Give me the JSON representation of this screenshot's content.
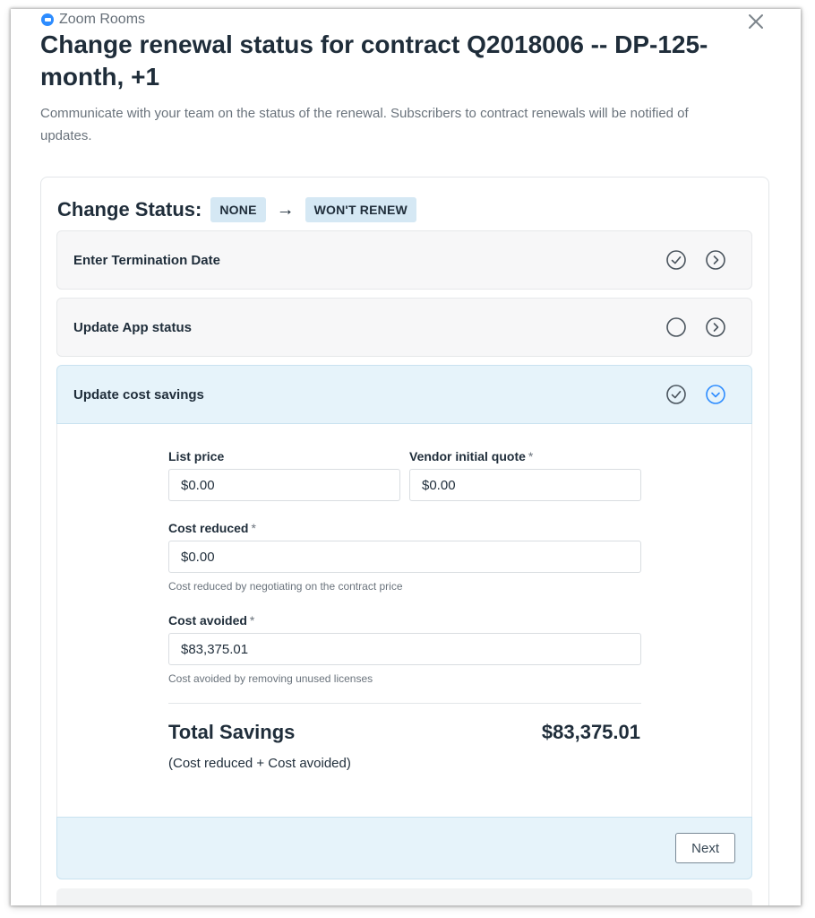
{
  "app": {
    "name": "Zoom Rooms"
  },
  "header": {
    "title": "Change renewal status for contract Q2018006 -- DP-125-month, +1",
    "subtitle": "Communicate with your team on the status of the renewal. Subscribers to contract renewals will be notified of updates."
  },
  "status": {
    "label": "Change Status:",
    "from": "NONE",
    "arrow": "→",
    "to": "WON'T RENEW"
  },
  "steps": [
    {
      "label": "Enter Termination Date",
      "complete": true,
      "expanded": false
    },
    {
      "label": "Update App status",
      "complete": false,
      "expanded": false
    },
    {
      "label": "Update cost savings",
      "complete": true,
      "expanded": true
    }
  ],
  "form": {
    "list_price": {
      "label": "List price",
      "value": "$0.00"
    },
    "vendor_quote": {
      "label": "Vendor initial quote",
      "required": "*",
      "value": "$0.00"
    },
    "cost_reduced": {
      "label": "Cost reduced",
      "required": "*",
      "value": "$0.00",
      "hint": "Cost reduced by negotiating on the contract price"
    },
    "cost_avoided": {
      "label": "Cost avoided",
      "required": "*",
      "value": "$83,375.01",
      "hint": "Cost avoided by removing unused licenses"
    }
  },
  "totals": {
    "label": "Total Savings",
    "value": "$83,375.01",
    "note": "(Cost reduced + Cost avoided)"
  },
  "actions": {
    "next_label": "Next"
  },
  "icons": {
    "app": "zoom-logo-icon",
    "close": "close-icon",
    "check": "check-circle-icon",
    "empty": "empty-circle-icon",
    "chevron_right": "chevron-right-circle-icon",
    "chevron_down": "chevron-down-circle-icon"
  },
  "colors": {
    "pill_bg": "#d5e8f4",
    "active_bg": "#e6f3fa",
    "accent": "#2d8cff",
    "text": "#1f2d3a"
  }
}
